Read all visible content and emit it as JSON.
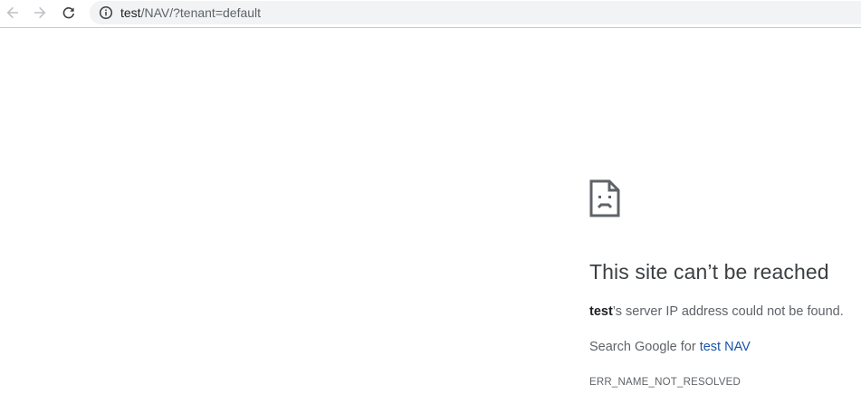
{
  "address_bar": {
    "host": "test",
    "path": "/NAV/?tenant=default"
  },
  "icons": {
    "back": "arrow-left-icon",
    "forward": "arrow-right-icon",
    "reload": "reload-icon",
    "site_info": "info-icon",
    "error": "sad-page-icon"
  },
  "error": {
    "title": "This site can’t be reached",
    "host_bold": "test",
    "desc_rest": "’s server IP address could not be found.",
    "suggestion_prefix": "Search Google for ",
    "suggestion_link": "test NAV",
    "code": "ERR_NAME_NOT_RESOLVED"
  },
  "colors": {
    "link": "#1a55a8",
    "omnibox_bg": "#f1f3f4",
    "title": "#3c4043",
    "muted": "#5f6368"
  }
}
